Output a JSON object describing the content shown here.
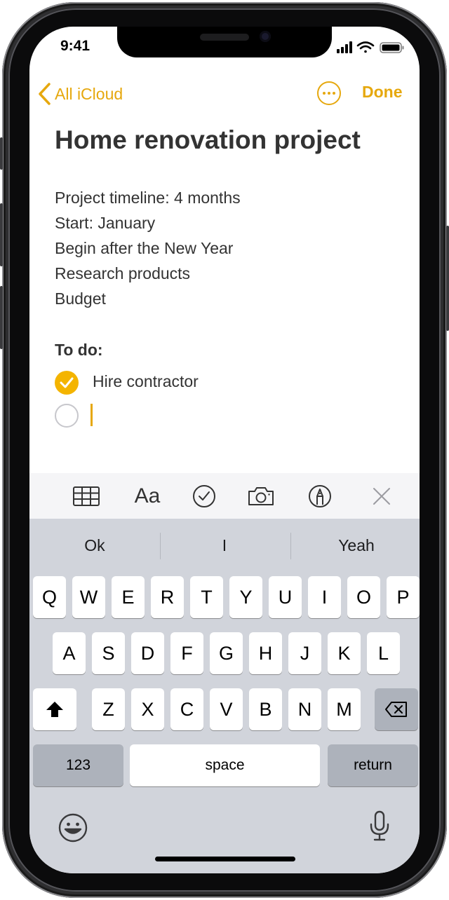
{
  "status_bar": {
    "time": "9:41"
  },
  "nav": {
    "back_label": "All iCloud",
    "done_label": "Done",
    "more_icon": "ellipsis-circle-icon",
    "back_icon": "chevron-left-icon"
  },
  "note": {
    "title": "Home renovation project",
    "lines": [
      "Project timeline: 4 months",
      "Start: January",
      "Begin after the New Year",
      "Research products",
      "Budget"
    ],
    "todo_heading": "To do:",
    "checklist": [
      {
        "text": "Hire contractor",
        "checked": true
      },
      {
        "text": "",
        "checked": false
      }
    ]
  },
  "toolbar": {
    "aa_label": "Aa",
    "icons": [
      "table-icon",
      "format-text-icon",
      "checklist-icon",
      "camera-icon",
      "markup-pen-icon",
      "close-icon"
    ]
  },
  "keyboard": {
    "suggestions": [
      "Ok",
      "I",
      "Yeah"
    ],
    "row1": [
      "Q",
      "W",
      "E",
      "R",
      "T",
      "Y",
      "U",
      "I",
      "O",
      "P"
    ],
    "row2": [
      "A",
      "S",
      "D",
      "F",
      "G",
      "H",
      "J",
      "K",
      "L"
    ],
    "row3": [
      "Z",
      "X",
      "C",
      "V",
      "B",
      "N",
      "M"
    ],
    "numbers_label": "123",
    "space_label": "space",
    "return_label": "return"
  },
  "colors": {
    "accent": "#e6a80e",
    "check_fill": "#f4b400",
    "keyboard_bg": "#d1d4db"
  }
}
